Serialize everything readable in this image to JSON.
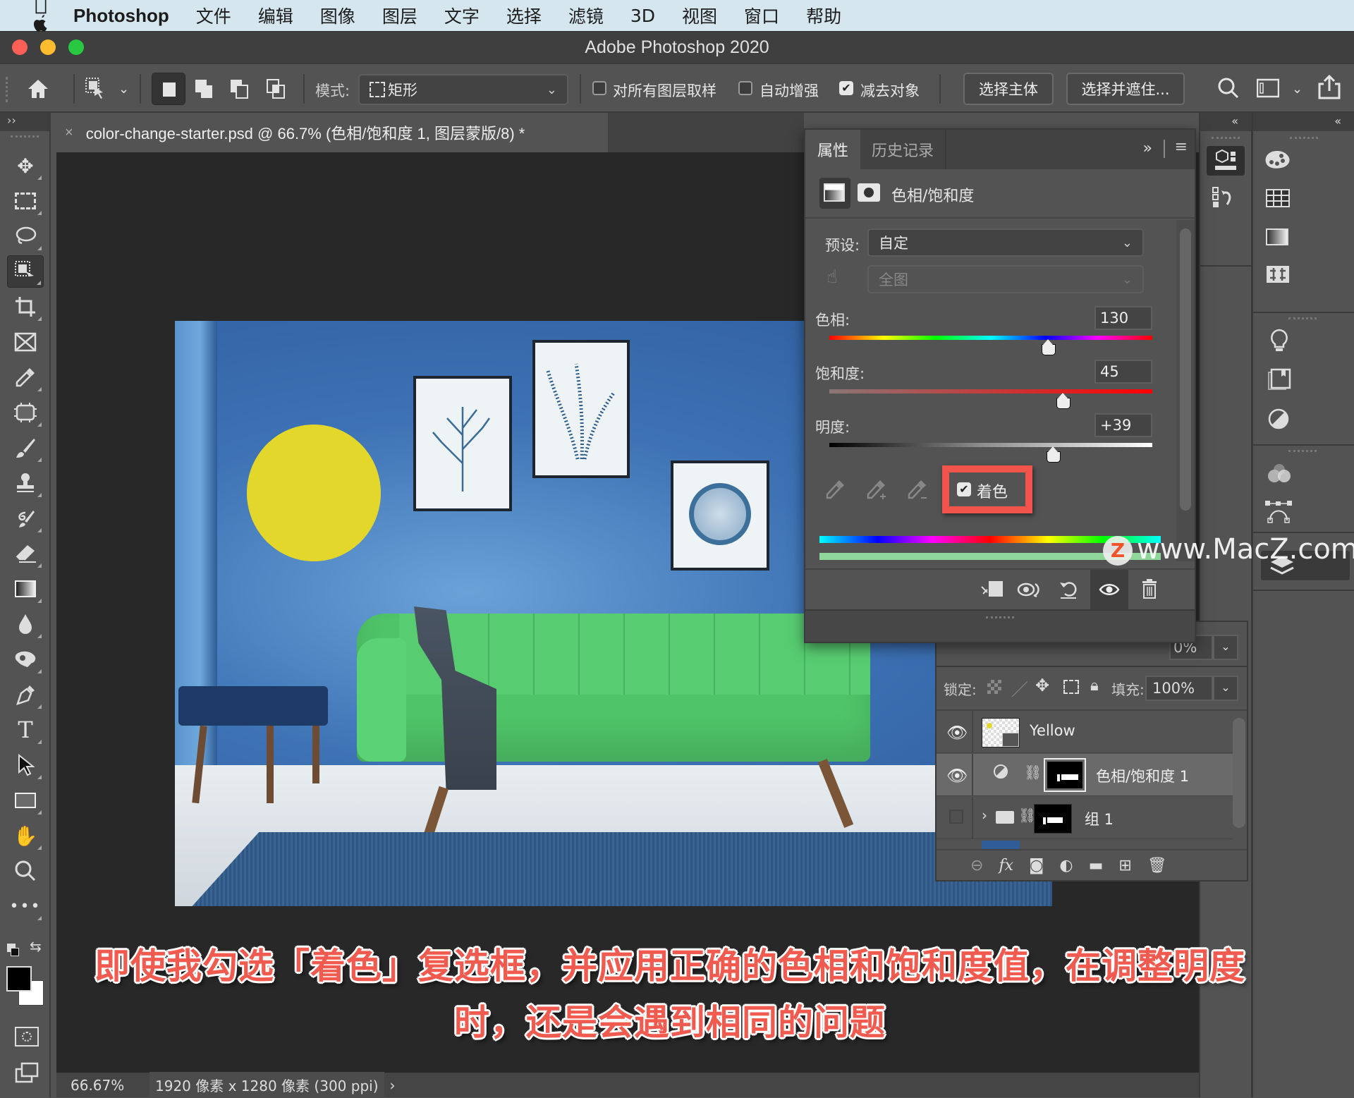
{
  "menubar": {
    "apple": "",
    "app": "Photoshop",
    "items": [
      "文件",
      "编辑",
      "图像",
      "图层",
      "文字",
      "选择",
      "滤镜",
      "3D",
      "视图",
      "窗口",
      "帮助"
    ]
  },
  "window": {
    "title": "Adobe Photoshop 2020"
  },
  "options": {
    "mode_label": "模式:",
    "mode_value": "矩形",
    "sample_all_layers": {
      "label": "对所有图层取样",
      "checked": false
    },
    "auto_enhance": {
      "label": "自动增强",
      "checked": false
    },
    "subtract_object": {
      "label": "减去对象",
      "checked": true
    },
    "select_subject": "选择主体",
    "select_and_mask": "选择并遮住..."
  },
  "document": {
    "tab_title": "color-change-starter.psd @ 66.7% (色相/饱和度 1, 图层蒙版/8) *",
    "close": "×"
  },
  "statusbar": {
    "zoom": "66.67%",
    "info": "1920 像素 x 1280 像素 (300 ppi)",
    "arrow": "›"
  },
  "properties": {
    "tabs": [
      "属性",
      "历史记录"
    ],
    "active_tab": "属性",
    "collapse": "»",
    "adjustment_title": "色相/饱和度",
    "preset_label": "预设:",
    "preset_value": "自定",
    "range_value": "全图",
    "hue": {
      "label": "色相:",
      "value": "130",
      "fraction": 0.68
    },
    "saturation": {
      "label": "饱和度:",
      "value": "45",
      "fraction": 0.725
    },
    "lightness": {
      "label": "明度:",
      "value": "+39",
      "fraction": 0.695
    },
    "colorize": {
      "label": "着色",
      "checked": true
    },
    "highlight_color": "#f0544a"
  },
  "layers": {
    "opacity_partial": "0%",
    "lock_label": "锁定:",
    "fill_label": "填充:",
    "fill_value": "100%",
    "rows": [
      {
        "name": "Yellow",
        "visible": true,
        "type": "smart-object"
      },
      {
        "name": "色相/饱和度 1",
        "visible": true,
        "type": "adjustment",
        "selected": true
      },
      {
        "name": "组 1",
        "visible": false,
        "type": "group"
      }
    ]
  },
  "panels": {
    "collapse_left": "«",
    "collapse_right": "«"
  },
  "caption": {
    "line1": "即使我勾选「着色」复选框，并应用正确的色相和饱和度值，在调整明度",
    "line2": "时，还是会遇到相同的问题"
  },
  "watermark": {
    "text": "www.MacZ.com",
    "logo": "Z"
  },
  "colors": {
    "accent_red": "#f0544a",
    "sofa_green": "#4fc468",
    "wall_blue": "#3b6faf",
    "sun_yellow": "#e4d72b"
  }
}
